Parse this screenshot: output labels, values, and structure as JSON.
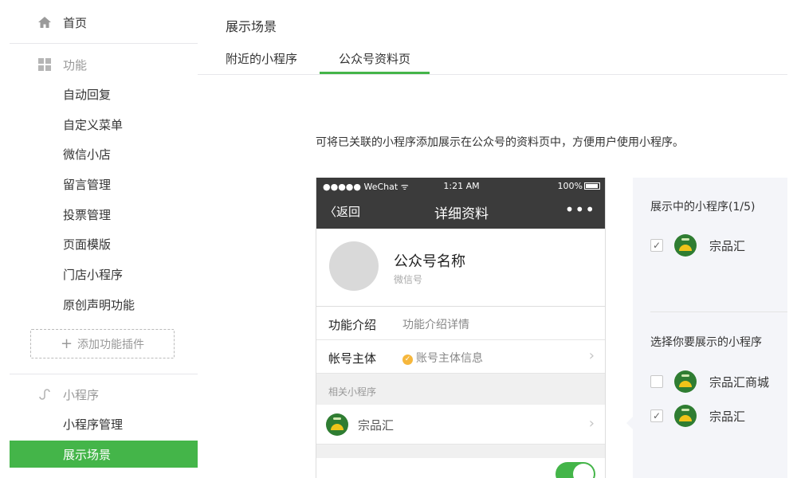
{
  "sidebar": {
    "home": "首页",
    "function_header": "功能",
    "function_items": [
      "自动回复",
      "自定义菜单",
      "微信小店",
      "留言管理",
      "投票管理",
      "页面模版",
      "门店小程序",
      "原创声明功能"
    ],
    "add_plugin": "添加功能插件",
    "miniprogram_header": "小程序",
    "miniprogram_items": [
      "小程序管理",
      "展示场景"
    ],
    "active_item": "展示场景"
  },
  "main": {
    "title": "展示场景",
    "tabs": [
      {
        "label": "附近的小程序",
        "active": false
      },
      {
        "label": "公众号资料页",
        "active": true
      }
    ],
    "description": "可将已关联的小程序添加展示在公众号的资料页中，方便用户使用小程序。"
  },
  "phone": {
    "status_left": "●●●●● WeChat ᯤ",
    "status_time": "1:21 AM",
    "status_battery": "100%",
    "back_label": "返回",
    "nav_title": "详细资料",
    "more": "•••",
    "account_name": "公众号名称",
    "account_sub": "微信号",
    "intro_key": "功能介绍",
    "intro_value": "功能介绍详情",
    "owner_key": "帐号主体",
    "owner_value": "账号主体信息",
    "related_label": "相关小程序",
    "related_name": "宗品汇",
    "chevron": "›"
  },
  "panel": {
    "shown_title": "展示中的小程序(1/5)",
    "shown_items": [
      {
        "name": "宗品汇",
        "checked": true
      }
    ],
    "choose_title": "选择你要展示的小程序",
    "choose_items": [
      {
        "name": "宗品汇商城",
        "checked": false
      },
      {
        "name": "宗品汇",
        "checked": true
      }
    ],
    "check_mark": "✓"
  },
  "colors": {
    "accent": "#44b549",
    "phone_bar": "#3b3b3b",
    "panel_bg": "#f4f5f9"
  }
}
